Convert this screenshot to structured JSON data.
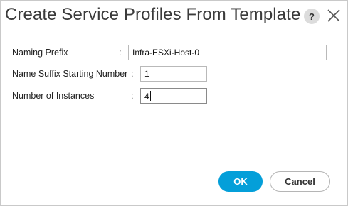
{
  "dialog": {
    "title": "Create Service Profiles From Template",
    "help_label": "?"
  },
  "form": {
    "naming_prefix": {
      "label": "Naming Prefix",
      "colon": ":",
      "value": "Infra-ESXi-Host-0"
    },
    "name_suffix_start": {
      "label": "Name Suffix Starting Number",
      "colon": ":",
      "value": "1"
    },
    "num_instances": {
      "label": "Number of Instances",
      "colon": ":",
      "value": "4"
    }
  },
  "buttons": {
    "ok_label": "OK",
    "cancel_label": "Cancel"
  },
  "colors": {
    "primary": "#049fd9",
    "title_text": "#3b3b3b"
  },
  "icons": {
    "help": "help-icon",
    "close": "close-icon"
  }
}
